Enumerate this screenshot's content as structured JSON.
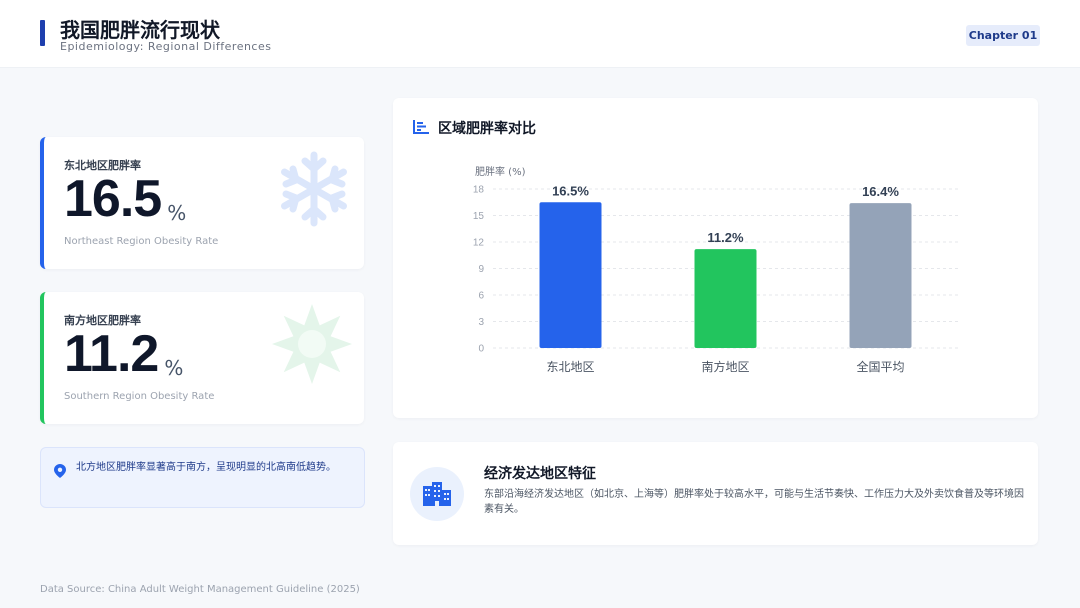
{
  "header": {
    "title": "我国肥胖流行现状",
    "subtitle": "Epidemiology: Regional Differences",
    "chapter": "Chapter 01"
  },
  "stats": [
    {
      "label": "东北地区肥胖率",
      "value": "16.5",
      "unit": "%",
      "english": "Northeast Region Obesity Rate",
      "icon": "snowflake-icon",
      "color": "#2563eb"
    },
    {
      "label": "南方地区肥胖率",
      "value": "11.2",
      "unit": "%",
      "english": "Southern Region Obesity Rate",
      "icon": "sun-icon",
      "color": "#22c55e"
    }
  ],
  "note": {
    "icon": "map-pin-icon",
    "text": "北方地区肥胖率显著高于南方，呈现明显的北高南低趋势。"
  },
  "chart_panel": {
    "title": "区域肥胖率对比",
    "icon": "bar-chart-icon"
  },
  "chart_data": {
    "type": "bar",
    "title": "区域肥胖率对比",
    "ylabel": "肥胖率 (%)",
    "xlabel": "",
    "categories": [
      "东北地区",
      "南方地区",
      "全国平均"
    ],
    "values": [
      16.5,
      11.2,
      16.4
    ],
    "value_labels": [
      "16.5%",
      "11.2%",
      "16.4%"
    ],
    "colors": [
      "#2563eb",
      "#22c55e",
      "#94a3b8"
    ],
    "ylim": [
      0,
      18
    ],
    "yticks": [
      0,
      3,
      6,
      9,
      12,
      15,
      18
    ],
    "grid": true,
    "legend": "none"
  },
  "feature": {
    "icon": "city-buildings-icon",
    "title": "经济发达地区特征",
    "text": "东部沿海经济发达地区（如北京、上海等）肥胖率处于较高水平，可能与生活节奏快、工作压力大及外卖饮食普及等环境因素有关。"
  },
  "footer": {
    "source": "Data Source: China Adult Weight Management Guideline (2025)"
  }
}
